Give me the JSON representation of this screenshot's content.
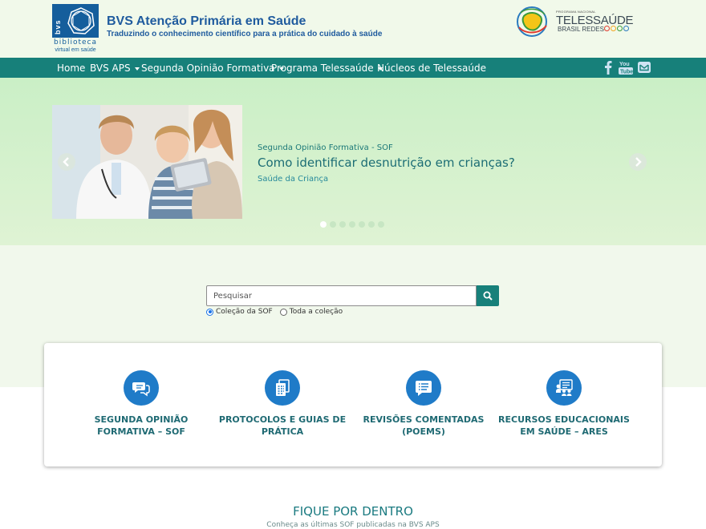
{
  "header": {
    "logo": {
      "vertical_text": "bvs",
      "line1": "biblioteca",
      "line2": "virtual em saúde"
    },
    "title": "BVS Atenção Primária em Saúde",
    "subtitle": "Traduzindo o conhecimento científico para a prática do cuidado à saúde",
    "partner_logo": {
      "small": "PROGRAMA NACIONAL",
      "main": "TELESSAÚDE",
      "sub": "BRASIL REDES"
    }
  },
  "nav": {
    "items": [
      {
        "label": "Home"
      },
      {
        "label": "BVS APS"
      },
      {
        "label": "Segunda Opinião Formativa"
      },
      {
        "label": "Programa Telessaúde"
      },
      {
        "label": "Núcleos de Telessaúde"
      }
    ],
    "social": [
      "facebook-icon",
      "youtube-icon",
      "email-icon"
    ]
  },
  "hero": {
    "kicker": "Segunda Opinião Formativa - SOF",
    "title": "Como identificar desnutrição em crianças?",
    "tag": "Saúde da Criança",
    "slide_count": 7,
    "active_slide": 1
  },
  "search": {
    "placeholder": "Pesquisar",
    "options": [
      {
        "label": "Coleção da SOF",
        "checked": true
      },
      {
        "label": "Toda a coleção",
        "checked": false
      }
    ]
  },
  "cards": [
    {
      "line1": "SEGUNDA OPINIÃO",
      "line2": "FORMATIVA – SOF",
      "icon": "chat-bubbles-icon"
    },
    {
      "line1": "PROTOCOLOS E GUIAS DE",
      "line2": "PRÁTICA",
      "icon": "documents-icon"
    },
    {
      "line1": "REVISÕES COMENTADAS",
      "line2": "(POEMS)",
      "icon": "comment-list-icon"
    },
    {
      "line1": "RECURSOS EDUCACIONAIS",
      "line2": "EM SAÚDE – ARES",
      "icon": "education-icon"
    }
  ],
  "section": {
    "title": "FIQUE POR DENTRO",
    "subtitle": "Conheça as últimas SOF publicadas na BVS APS"
  },
  "colors": {
    "nav_bg": "#17807a",
    "brand_blue": "#1f5b9e",
    "card_icon": "#1f7bc8",
    "card_text": "#1f6a73"
  }
}
